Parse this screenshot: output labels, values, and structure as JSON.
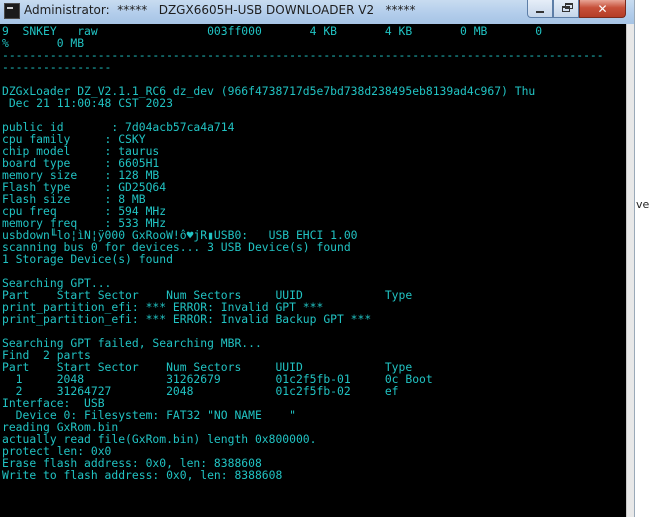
{
  "window": {
    "title": "Administrator:  *****   DZGX6605H-USB DOWNLOADER V2   *****",
    "minimize_icon": "minimize-icon",
    "maximize_icon": "restore-icon",
    "close_icon": "close-icon",
    "close_glyph": "✕"
  },
  "console": {
    "text_color": "#21c3c3",
    "background": "#000000",
    "lines": [
      "9  SNKEY   raw                003ff000       4 KB       4 KB       0 MB       0",
      "%       0 MB",
      "----------------------------------------------------------------------------------------",
      "----------------",
      "",
      "DZGxLoader DZ_V2.1.1_RC6 dz_dev (966f4738717d5e7bd738d238495eb8139ad4c967) Thu",
      " Dec 21 11:00:48 CST 2023",
      "",
      "public id       : 7d04acb57ca4a714",
      "cpu family     : CSKY",
      "chip model     : taurus",
      "board type     : 6605H1",
      "memory size    : 128 MB",
      "Flash type     : GD25Q64",
      "Flash size     : 8 MB",
      "cpu freq       : 594 MHz",
      "memory freq    : 533 MHz",
      "usbdown╙lo¦ìN¦ÿ000 GxRooW!ô♥jR▮USB0:   USB EHCI 1.00",
      "scanning bus 0 for devices... 3 USB Device(s) found",
      "1 Storage Device(s) found",
      "",
      "Searching GPT...",
      "Part    Start Sector    Num Sectors     UUID            Type",
      "print_partition_efi: *** ERROR: Invalid GPT ***",
      "print_partition_efi: *** ERROR: Invalid Backup GPT ***",
      "",
      "Searching GPT failed, Searching MBR...",
      "Find  2 parts",
      "Part    Start Sector    Num Sectors     UUID            Type",
      "  1     2048            31262679        01c2f5fb-01     0c Boot",
      "  2     31264727        2048            01c2f5fb-02     ef",
      "Interface:  USB",
      "  Device 0: Filesystem: FAT32 \"NO NAME    \"",
      "reading GxRom.bin",
      "actually read file(GxRom.bin) length 0x800000.",
      "protect len: 0x0",
      "Erase flash address: 0x0, len: 8388608",
      "Write to flash address: 0x0, len: 8388608"
    ]
  },
  "background_window": {
    "partial_text": "ve"
  }
}
